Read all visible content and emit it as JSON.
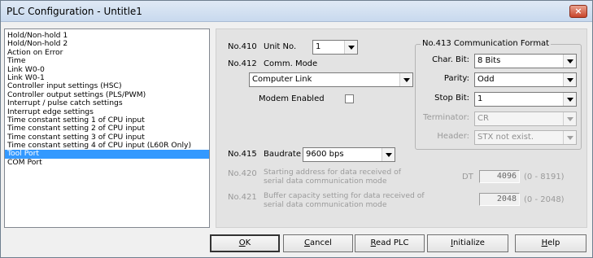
{
  "window": {
    "title": "PLC Configuration - Untitle1",
    "close_glyph": "×"
  },
  "list": {
    "items": [
      "Hold/Non-hold 1",
      "Hold/Non-hold 2",
      "Action on Error",
      "Time",
      "Link W0-0",
      "Link W0-1",
      "Controller input settings (HSC)",
      "Controller output settings (PLS/PWM)",
      "Interrupt / pulse catch settings",
      "Interrupt edge settings",
      "Time constant setting 1 of CPU input",
      "Time constant setting 2 of CPU input",
      "Time constant setting 3 of CPU input",
      "Time constant setting 4 of CPU input (L60R Only)",
      "Tool Port",
      "COM Port"
    ],
    "selected_index": 14
  },
  "panel": {
    "no410": "No.410",
    "unit_no_label": "Unit No.",
    "unit_no_value": "1",
    "no412": "No.412",
    "comm_mode_label": "Comm. Mode",
    "comm_mode_value": "Computer Link",
    "modem_label": "Modem Enabled",
    "no415": "No.415",
    "baudrate_label": "Baudrate",
    "baudrate_value": "9600 bps",
    "no420": "No.420",
    "no420_text1": "Starting address for data received of",
    "no420_text2": "serial data communication mode",
    "dt_label": "DT",
    "dt_value": "4096",
    "dt_range": "(0 - 8191)",
    "no421": "No.421",
    "no421_text1": "Buffer capacity setting for data received of",
    "no421_text2": "serial data communication mode",
    "buffer_value": "2048",
    "buffer_range": "(0 - 2048)",
    "comm_format": {
      "title": "No.413 Communication Format",
      "char_bit_label": "Char. Bit:",
      "char_bit_value": "8 Bits",
      "parity_label": "Parity:",
      "parity_value": "Odd",
      "stop_bit_label": "Stop Bit:",
      "stop_bit_value": "1",
      "terminator_label": "Terminator:",
      "terminator_value": "CR",
      "header_label": "Header:",
      "header_value": "STX not exist."
    }
  },
  "buttons": {
    "ok_u": "O",
    "ok_rest": "K",
    "cancel_u": "C",
    "cancel_rest": "ancel",
    "read_u": "R",
    "read_rest": "ead PLC",
    "init_u": "I",
    "init_rest": "nitialize",
    "help_u": "H",
    "help_rest": "elp"
  }
}
